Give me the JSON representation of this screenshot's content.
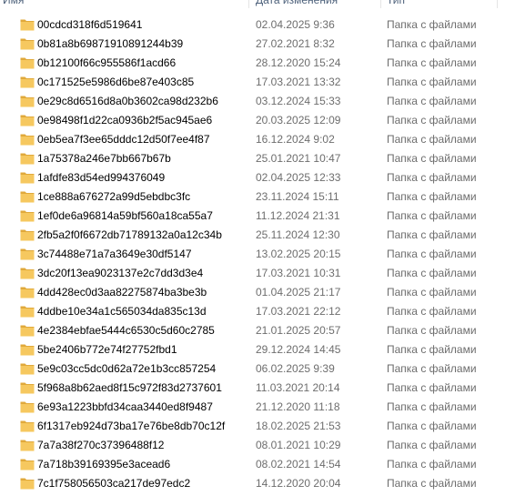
{
  "columns": {
    "name": "Имя",
    "date": "Дата изменения",
    "type": "Тип"
  },
  "rows": [
    {
      "name": "00cdcd318f6d519641",
      "date": "02.04.2025 9:36",
      "type": "Папка с файлами"
    },
    {
      "name": "0b81a8b69871910891244b39",
      "date": "27.02.2021 8:32",
      "type": "Папка с файлами"
    },
    {
      "name": "0b12100f66c955586f1acd66",
      "date": "28.12.2020 15:24",
      "type": "Папка с файлами"
    },
    {
      "name": "0c171525e5986d6be87e403c85",
      "date": "17.03.2021 13:32",
      "type": "Папка с файлами"
    },
    {
      "name": "0e29c8d6516d8a0b3602ca98d232b6",
      "date": "03.12.2024 15:33",
      "type": "Папка с файлами"
    },
    {
      "name": "0e98498f1d22ca0936b2f5ac945ae6",
      "date": "20.03.2025 12:09",
      "type": "Папка с файлами"
    },
    {
      "name": "0eb5ea7f3ee65dddc12d50f7ee4f87",
      "date": "16.12.2024 9:02",
      "type": "Папка с файлами"
    },
    {
      "name": "1a75378a246e7bb667b67b",
      "date": "25.01.2021 10:47",
      "type": "Папка с файлами"
    },
    {
      "name": "1afdfe83d54ed994376049",
      "date": "02.04.2025 12:33",
      "type": "Папка с файлами"
    },
    {
      "name": "1ce888a676272a99d5ebdbc3fc",
      "date": "23.11.2024 15:11",
      "type": "Папка с файлами"
    },
    {
      "name": "1ef0de6a96814a59bf560a18ca55a7",
      "date": "11.12.2024 21:31",
      "type": "Папка с файлами"
    },
    {
      "name": "2fb5a2f0f6672db71789132a0a12c34b",
      "date": "25.11.2024 12:30",
      "type": "Папка с файлами"
    },
    {
      "name": "3c74488e71a7a3649e30df5147",
      "date": "13.02.2025 20:15",
      "type": "Папка с файлами"
    },
    {
      "name": "3dc20f13ea9023137e2c7dd3d3e4",
      "date": "17.03.2021 10:31",
      "type": "Папка с файлами"
    },
    {
      "name": "4dd428ec0d3aa82275874ba3be3b",
      "date": "01.04.2025 21:17",
      "type": "Папка с файлами"
    },
    {
      "name": "4ddbe10e34a1c565034da835c13d",
      "date": "17.03.2021 22:12",
      "type": "Папка с файлами"
    },
    {
      "name": "4e2384ebfae5444c6530c5d60c2785",
      "date": "21.01.2025 20:57",
      "type": "Папка с файлами"
    },
    {
      "name": "5be2406b772e74f27752fbd1",
      "date": "29.12.2024 14:45",
      "type": "Папка с файлами"
    },
    {
      "name": "5e9c03cc5dc0d62a72e1b3cc857254",
      "date": "06.02.2025 9:39",
      "type": "Папка с файлами"
    },
    {
      "name": "5f968a8b62aed8f15c972f83d2737601",
      "date": "11.03.2021 20:14",
      "type": "Папка с файлами"
    },
    {
      "name": "6e93a1223bbfd34caa3440ed8f9487",
      "date": "21.12.2020 11:18",
      "type": "Папка с файлами"
    },
    {
      "name": "6f1317eb924d73ba17e76be8db70c12f",
      "date": "18.02.2025 21:53",
      "type": "Папка с файлами"
    },
    {
      "name": "7a7a38f270c37396488f12",
      "date": "08.01.2021 10:29",
      "type": "Папка с файлами"
    },
    {
      "name": "7a718b39169395e3acead6",
      "date": "08.02.2021 14:54",
      "type": "Папка с файлами"
    },
    {
      "name": "7c1f758056503ca217de97edc2",
      "date": "14.12.2020 20:04",
      "type": "Папка с файлами"
    }
  ],
  "icon": "folder-icon",
  "colors": {
    "folder_body": "#f6c85f",
    "folder_back": "#e0a93b",
    "secondary_text": "#6d6d6d",
    "header_text": "#4c607a"
  }
}
